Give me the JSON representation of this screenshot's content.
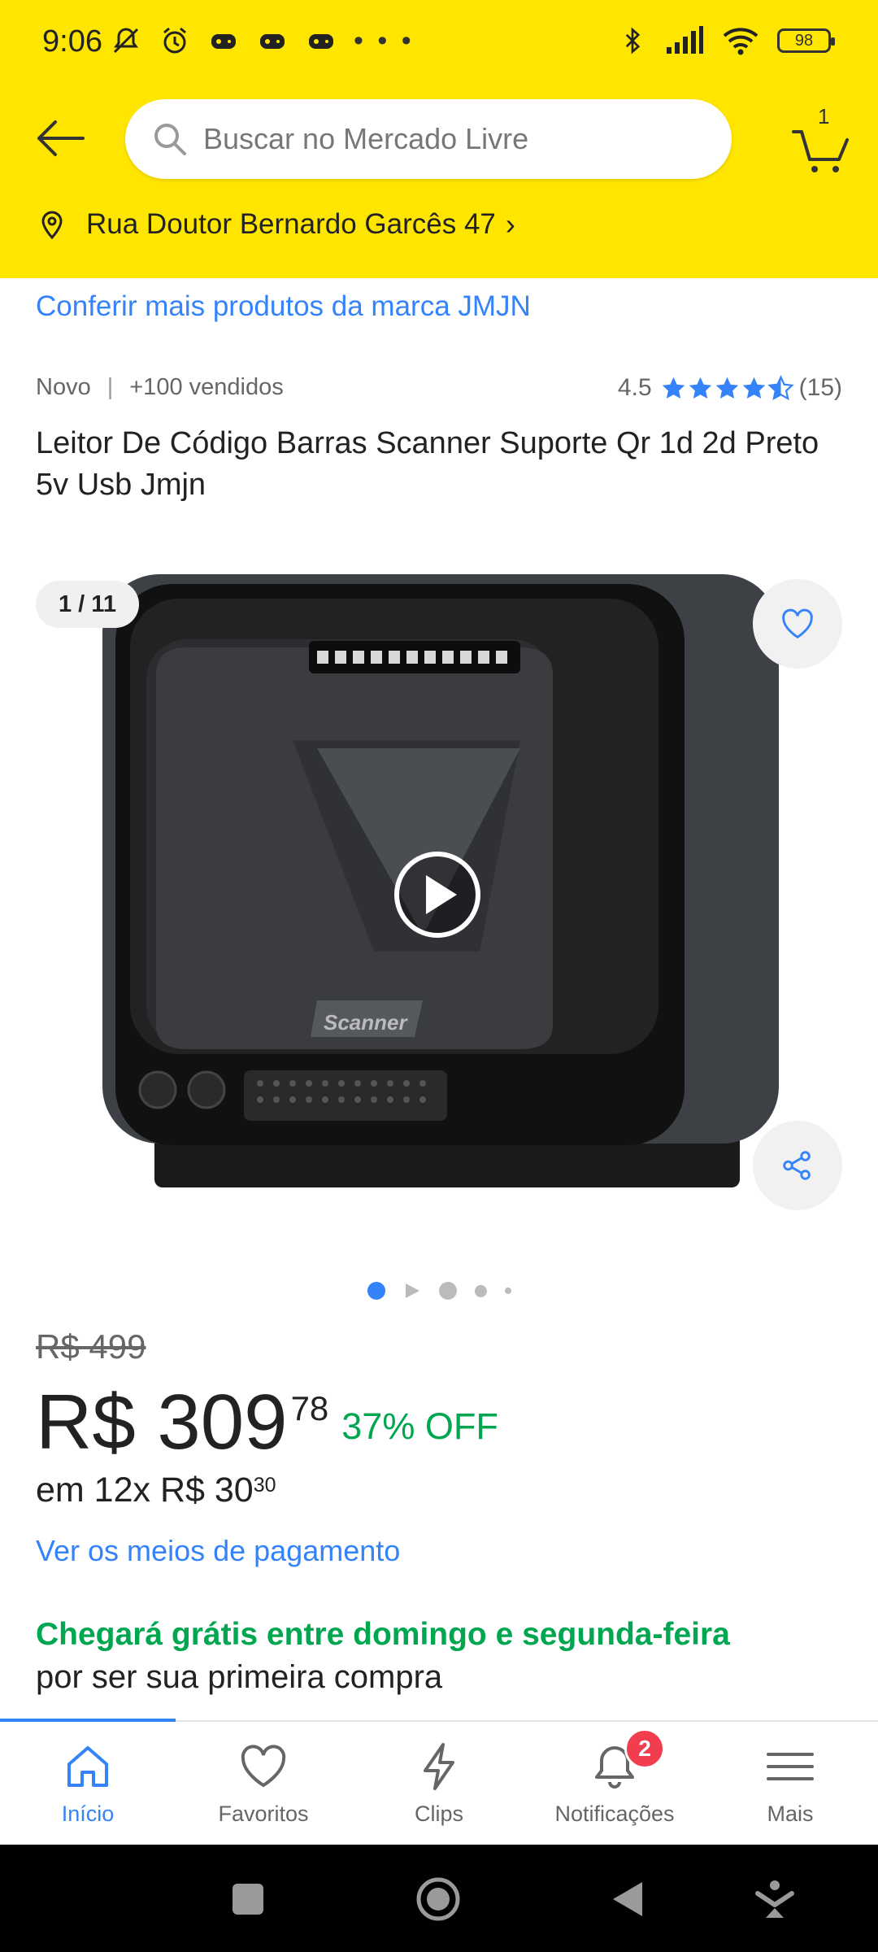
{
  "status_bar": {
    "time": "9:06",
    "dots": "• • •",
    "battery": "98"
  },
  "header": {
    "search_placeholder": "Buscar no Mercado Livre",
    "cart_count": "1",
    "address": "Rua Doutor Bernardo Garcês 47",
    "address_chevron": "›"
  },
  "product": {
    "brand_link": "Conferir mais produtos da marca JMJN",
    "condition": "Novo",
    "separator": "|",
    "sold": "+100 vendidos",
    "rating_value": "4.5",
    "rating_count": "(15)",
    "title": "Leitor De Código Barras Scanner Suporte Qr 1d 2d Preto 5v Usb Jmjn",
    "image_counter": "1 / 11",
    "image_text": "Scanner",
    "old_price": "R$ 499",
    "price": "R$ 309",
    "price_cents": "78",
    "discount": "37% OFF",
    "installments_prefix": "em 12x R$ 30",
    "installments_cents": "30",
    "payment_link": "Ver os meios de pagamento",
    "shipping": "Chegará grátis entre domingo e segunda-feira",
    "shipping_sub": "por ser sua primeira compra"
  },
  "bottom_nav": {
    "items": [
      {
        "label": "Início",
        "icon": "home-icon"
      },
      {
        "label": "Favoritos",
        "icon": "heart-icon"
      },
      {
        "label": "Clips",
        "icon": "lightning-icon"
      },
      {
        "label": "Notificações",
        "icon": "bell-icon"
      },
      {
        "label": "Mais",
        "icon": "menu-icon"
      }
    ],
    "notifications_badge": "2"
  },
  "colors": {
    "header": "#ffe600",
    "link": "#3483fa",
    "green": "#00a650",
    "badge": "#f23d4f"
  }
}
